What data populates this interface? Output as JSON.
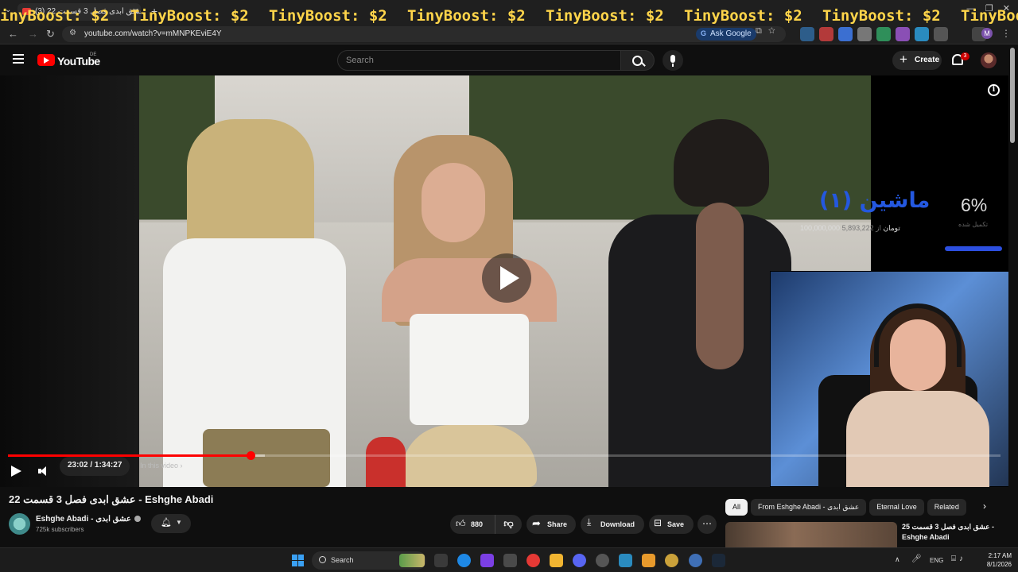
{
  "browser": {
    "tab_title": "(3) عشق ابدی فصل 3 قسمت 22",
    "url": "youtube.com/watch?v=mMNPKEviE4Y",
    "ask_google_label": "Ask Google",
    "profile_initial": "M",
    "overlay_banner_text": "TinyBoost: $2",
    "overlay_banner_partial_start": "inyBoost: $2",
    "overlay_banner_partial_end": "TinyBoo"
  },
  "youtube": {
    "wordmark": "YouTube",
    "country_code": "DE",
    "search_placeholder": "Search",
    "create_label": "Create",
    "notification_count": "3"
  },
  "player": {
    "current_time": "23:02",
    "duration": "1:34:27",
    "time_display": "23:02 / 1:34:27",
    "progress_fraction": 0.244,
    "buffered_fraction": 0.259,
    "chapter_chip_label": "In this video ›",
    "state": "paused",
    "overlay_graphic": {
      "title": "ماشین (۱)",
      "amount_label": "100,000,000",
      "amount_currency": "تومان",
      "amount_secondary": "از 5,893,222",
      "percent": "6%",
      "percent_label": "تکمیل شده"
    }
  },
  "video": {
    "title": "عشق ابدی فصل 3 قسمت 22 - Eshghe Abadi",
    "channel_name": "Eshghe Abadi - عشق ابدی",
    "subscribers": "725k subscribers",
    "like_count": "880",
    "share_label": "Share",
    "download_label": "Download",
    "save_label": "Save"
  },
  "sidebar": {
    "chips": [
      {
        "label": "All",
        "active": true
      },
      {
        "label": "From Eshghe Abadi - عشق ابدی",
        "active": false
      },
      {
        "label": "Eternal Love",
        "active": false
      },
      {
        "label": "Related",
        "active": false
      }
    ],
    "recommendation_title": "عشق ابدی فصل 3 قسمت 25 - Eshghe Abadi"
  },
  "taskbar": {
    "search_label": "Search",
    "language": "ENG",
    "time": "2:17 AM",
    "date": "8/1/2026"
  },
  "colors": {
    "youtube_red": "#ff0000",
    "page_background": "#0f0f0f",
    "banner_yellow": "#ffd54a",
    "graphic_blue": "#2458e0"
  }
}
